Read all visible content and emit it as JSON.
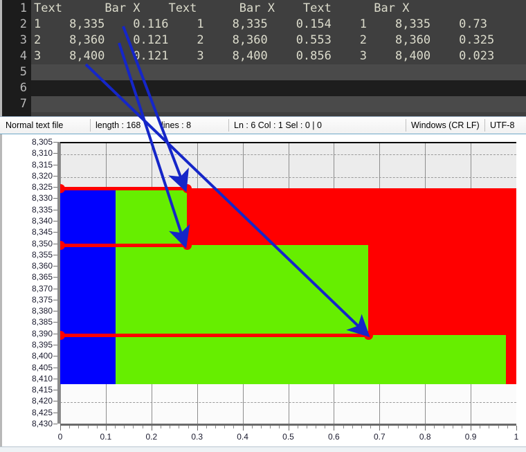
{
  "editor": {
    "line_numbers": [
      "1",
      "2",
      "3",
      "4",
      "5",
      "6",
      "7"
    ],
    "current_line": 6,
    "lines": [
      "Text      Bar X    Text      Bar X    Text      Bar X",
      "1    8,335    0.116    1    8,335    0.154    1    8,335    0.73",
      "2    8,360    0.121    2    8,360    0.553    2    8,360    0.325",
      "3    8,400    0.121    3    8,400    0.856    3    8,400    0.023",
      "",
      "",
      ""
    ]
  },
  "statusbar": {
    "file_type": "Normal text file",
    "length": "length : 168",
    "lines": "lines : 8",
    "position": "Ln : 6   Col : 1   Sel : 0 | 0",
    "eol": "Windows (CR LF)",
    "encoding": "UTF-8"
  },
  "chart_data": {
    "type": "bar",
    "title": "",
    "xlabel": "",
    "ylabel": "",
    "orientation": "horizontal",
    "stacked": true,
    "grid": true,
    "legend": "none",
    "xlim": [
      0,
      1
    ],
    "ylim": [
      8305,
      8430
    ],
    "y_inverted": true,
    "xticks": [
      "0",
      "0.1",
      "0.2",
      "0.3",
      "0.4",
      "0.5",
      "0.6",
      "0.7",
      "0.8",
      "0.9",
      "1"
    ],
    "xtick_values": [
      0,
      0.1,
      0.2,
      0.3,
      0.4,
      0.5,
      0.6,
      0.7,
      0.8,
      0.9,
      1
    ],
    "yticks": [
      "8,305",
      "8,310",
      "8,315",
      "8,320",
      "8,325",
      "8,330",
      "8,335",
      "8,340",
      "8,345",
      "8,350",
      "8,355",
      "8,360",
      "8,365",
      "8,370",
      "8,375",
      "8,380",
      "8,385",
      "8,390",
      "8,395",
      "8,400",
      "8,405",
      "8,410",
      "8,415",
      "8,420",
      "8,425",
      "8,430"
    ],
    "ytick_values": [
      8305,
      8310,
      8315,
      8320,
      8325,
      8330,
      8335,
      8340,
      8345,
      8350,
      8355,
      8360,
      8365,
      8370,
      8375,
      8380,
      8385,
      8390,
      8395,
      8400,
      8405,
      8410,
      8415,
      8420,
      8425,
      8430
    ],
    "series": [
      {
        "name": "Blue",
        "color": "#0000ff",
        "values": [
          0.116,
          0.121,
          0.121
        ]
      },
      {
        "name": "Green",
        "color": "#66ee00",
        "values": [
          0.154,
          0.553,
          0.856
        ]
      },
      {
        "name": "Red",
        "color": "#ff0000",
        "values": [
          0.73,
          0.325,
          0.023
        ]
      }
    ],
    "bands": [
      {
        "label": "1",
        "y_start": 8325,
        "y_end": 8350,
        "blue_end": 0.122,
        "green_end": 0.277,
        "red_end": 1.0
      },
      {
        "label": "2",
        "y_start": 8350,
        "y_end": 8390,
        "blue_end": 0.122,
        "green_end": 0.675,
        "red_end": 1.0
      },
      {
        "label": "3",
        "y_start": 8390,
        "y_end": 8412,
        "blue_end": 0.122,
        "green_end": 0.977,
        "red_end": 1.0
      }
    ],
    "markers": [
      {
        "x": 0.0,
        "y": 8325
      },
      {
        "x": 0.277,
        "y": 8325
      },
      {
        "x": 0.0,
        "y": 8350
      },
      {
        "x": 0.277,
        "y": 8350
      },
      {
        "x": 0.0,
        "y": 8390
      },
      {
        "x": 0.675,
        "y": 8390
      }
    ],
    "annotations": [
      {
        "label": "arrow-to-8335-band",
        "from_text": "8,335",
        "to_x": 0.277,
        "to_y": 8325
      },
      {
        "label": "arrow-to-8360-band",
        "from_text": "8,360",
        "to_x": 0.277,
        "to_y": 8350
      },
      {
        "label": "arrow-to-8400-band",
        "from_text": "8,400",
        "to_x": 0.675,
        "to_y": 8390
      }
    ]
  },
  "colors": {
    "blue": "#0000ff",
    "green": "#66ee00",
    "red": "#ff0000",
    "arrow": "#1526c8",
    "editor_bg": "#3f3f3f",
    "gutter_bg": "#1c1c1c"
  }
}
